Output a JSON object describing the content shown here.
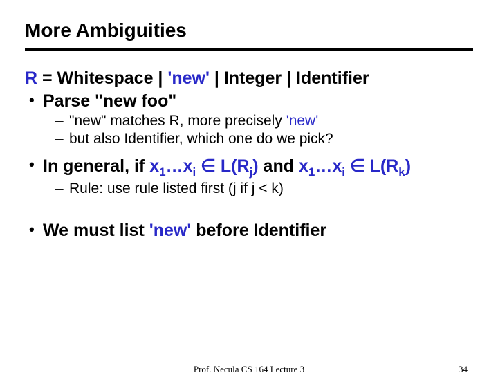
{
  "title": "More Ambiguities",
  "rdef": {
    "lhs": "R ",
    "eq": "= ",
    "rhs_a": "Whitespace | ",
    "rhs_b": "'new'",
    "rhs_c": " | Integer | Identifier"
  },
  "b1_parse": "Parse \"new foo\"",
  "b2_match_a": "\"new\" matches R, more precisely ",
  "b2_match_b": "'new'",
  "b2_also": "but also Identifier, which one do we pick?",
  "general": {
    "a": "In general, if ",
    "x1": "x",
    "sub1": "1",
    "dots": "…",
    "xi": "x",
    "subi": "i",
    "in": " ∈ ",
    "Lrj": "L(R",
    "subj": "j",
    "cl": ")",
    "and": " and ",
    "Lrk": "L(R",
    "subk": "k",
    "cl2": ")"
  },
  "rule": "Rule: use rule listed first (j if j < k)",
  "mustlist_a": "We must list ",
  "mustlist_b": "'new'",
  "mustlist_c": " before Identifier",
  "footer_center": "Prof. Necula  CS 164  Lecture 3",
  "page": "34"
}
